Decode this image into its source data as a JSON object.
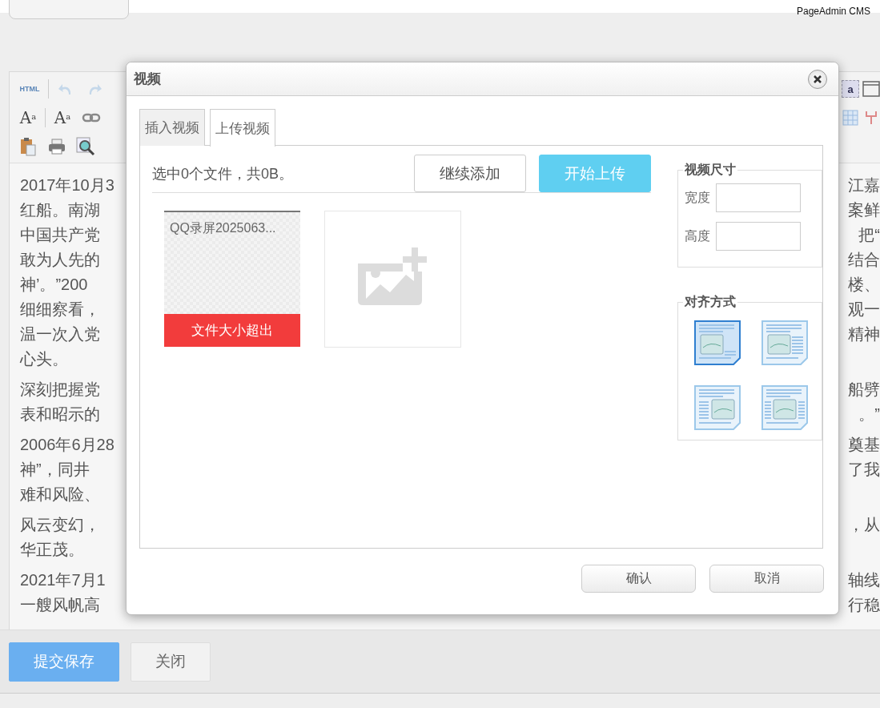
{
  "brand": "PageAdmin CMS",
  "toolbar": {
    "left_rows": [
      [
        {
          "kind": "html",
          "label": "HTML"
        },
        {
          "kind": "undo",
          "disabled": true
        },
        {
          "kind": "redo",
          "disabled": true
        }
      ],
      [
        {
          "kind": "font-up",
          "label": "A",
          "sub": "a"
        },
        {
          "kind": "font-down",
          "label": "A",
          "sub": "a"
        },
        {
          "kind": "link"
        }
      ],
      [
        {
          "kind": "paste"
        },
        {
          "kind": "print"
        },
        {
          "kind": "preview"
        }
      ]
    ],
    "right_rows": [
      [
        {
          "kind": "letter",
          "label": "a"
        },
        {
          "kind": "window"
        }
      ],
      [
        {
          "kind": "table"
        },
        {
          "kind": "plug"
        }
      ]
    ]
  },
  "editor": {
    "paragraphs": [
      {
        "lines": [
          {
            "left": "2017年10月3",
            "right": "江嘉"
          },
          {
            "left": "红船。南湖",
            "right": "案鲜"
          },
          {
            "left": "中国共产党",
            "right": "把“"
          },
          {
            "left": "敢为人先的",
            "right": "结合"
          },
          {
            "left": "神’。”200",
            "right": "楼、"
          },
          {
            "left": "细细察看，",
            "right": "观一"
          },
          {
            "left": "温一次入党",
            "right": "精神"
          },
          {
            "left": "心头。"
          }
        ]
      },
      {
        "lines": [
          {
            "left": "深刻把握党",
            "right": "船劈"
          },
          {
            "left": "表和昭示的",
            "right": "。”"
          }
        ]
      },
      {
        "lines": [
          {
            "left": "2006年6月28",
            "right": "奠基"
          },
          {
            "left": "神”，同井",
            "right": "了我"
          },
          {
            "left": "难和风险、"
          }
        ]
      },
      {
        "lines": [
          {
            "left": "风云变幻，",
            "right": "，从"
          },
          {
            "left": "华正茂。"
          }
        ]
      },
      {
        "lines": [
          {
            "left": "2021年7月1",
            "right": "轴线"
          },
          {
            "left": "一艘风帆高",
            "right": "行稳"
          }
        ]
      }
    ]
  },
  "footer": {
    "buttons": [
      {
        "label": "提交保存",
        "primary": true
      },
      {
        "label": "关闭",
        "primary": false
      }
    ]
  },
  "dialog": {
    "title": "视频",
    "tabs": [
      {
        "label": "插入视频",
        "selected": false
      },
      {
        "label": "上传视频",
        "selected": true
      }
    ],
    "status": "选中0个文件，共0B。",
    "upload_buttons": [
      {
        "label": "继续添加",
        "primary": false
      },
      {
        "label": "开始上传",
        "primary": true
      }
    ],
    "files": [
      {
        "name": "QQ录屏2025063...",
        "error": "文件大小超出"
      }
    ],
    "size": {
      "legend": "视频尺寸",
      "fields": [
        {
          "label": "宽度"
        },
        {
          "label": "高度"
        }
      ]
    },
    "align": {
      "legend": "对齐方式",
      "options": [
        {
          "kind": "none",
          "selected": true
        },
        {
          "kind": "right",
          "selected": false
        },
        {
          "kind": "left",
          "selected": false
        },
        {
          "kind": "center",
          "selected": false
        }
      ]
    },
    "buttons": [
      "确认",
      "取消"
    ]
  }
}
